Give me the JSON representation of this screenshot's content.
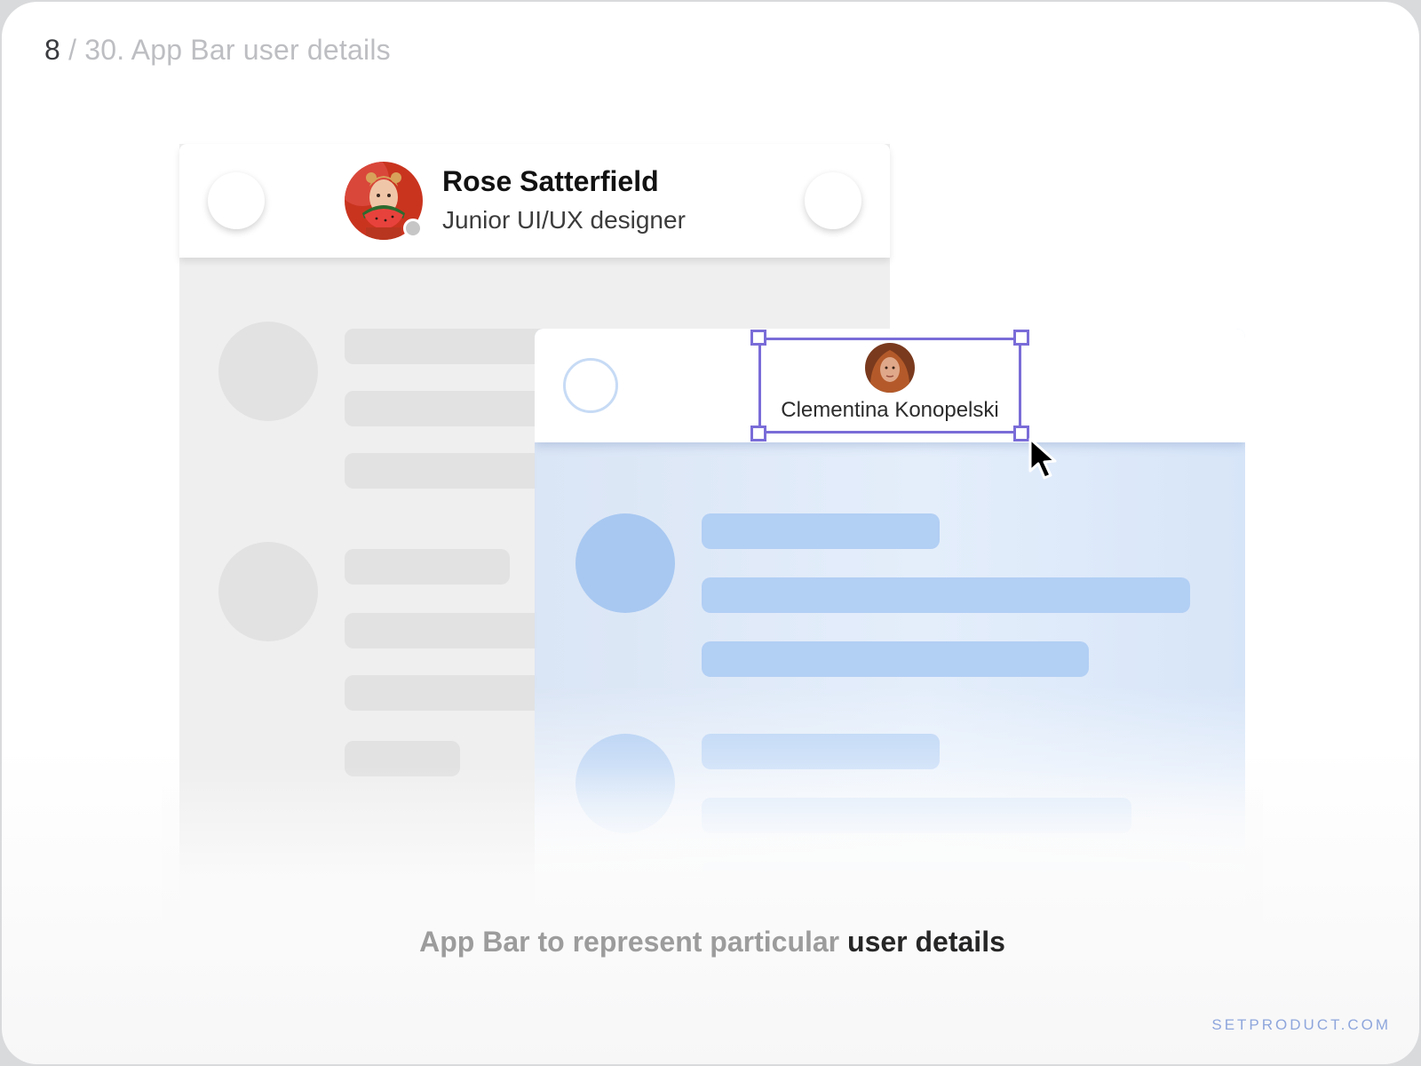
{
  "slide": {
    "number": "8",
    "title_rest": " / 30. App Bar user details"
  },
  "primary_appbar": {
    "user_name": "Rose Satterfield",
    "user_role": "Junior UI/UX designer",
    "status": "offline"
  },
  "secondary_appbar": {
    "user_name": "Clementina Konopelski"
  },
  "caption": {
    "lead": "App Bar to represent particular ",
    "emphasis": "user details"
  },
  "brand": "SETPRODUCT.COM",
  "colors": {
    "selection": "#7a6cd8",
    "skeleton_gray": "#e2e2e2",
    "skeleton_blue": "#b2cff4",
    "brand_text": "#8ea6dc"
  },
  "icons": [
    "left-action-icon",
    "right-action-icon",
    "cursor-arrow-icon",
    "status-dot-icon"
  ]
}
